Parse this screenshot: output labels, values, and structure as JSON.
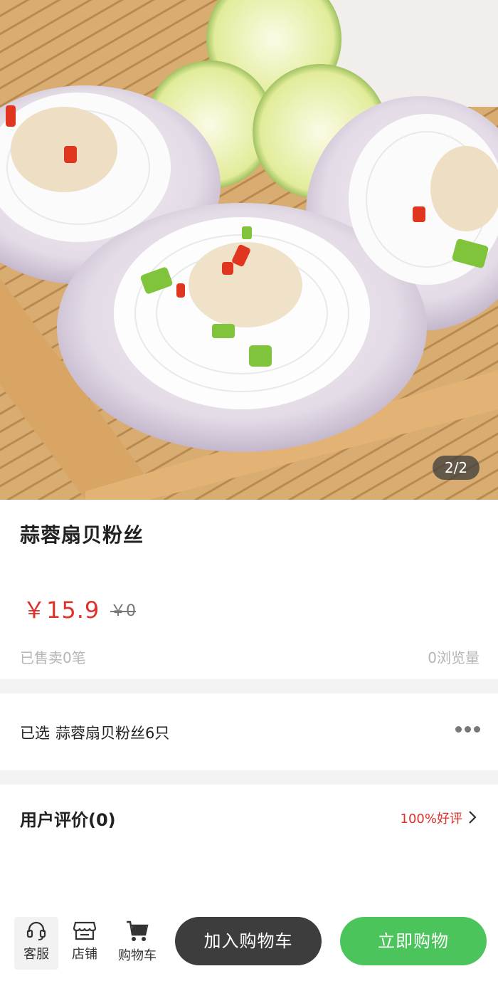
{
  "gallery": {
    "pager_text": "2/2"
  },
  "product": {
    "title": "蒜蓉扇贝粉丝",
    "price": "￥15.9",
    "original_price": "￥0",
    "sold": "已售卖0笔",
    "views": "0浏览量"
  },
  "selection": {
    "label": "已选",
    "value": "蒜蓉扇贝粉丝6只"
  },
  "reviews": {
    "title": "用户评价(0)",
    "rating": "100%好评"
  },
  "bottom_bar": {
    "service_label": "客服",
    "store_label": "店铺",
    "cart_label": "购物车",
    "add_to_cart_label": "加入购物车",
    "buy_now_label": "立即购物"
  },
  "colors": {
    "price": "#e0302a",
    "buy_button": "#4cc45c",
    "add_button": "#3d3d3d"
  },
  "icons": [
    "headset-icon",
    "store-icon",
    "cart-icon",
    "more-icon",
    "chevron-right-icon"
  ]
}
